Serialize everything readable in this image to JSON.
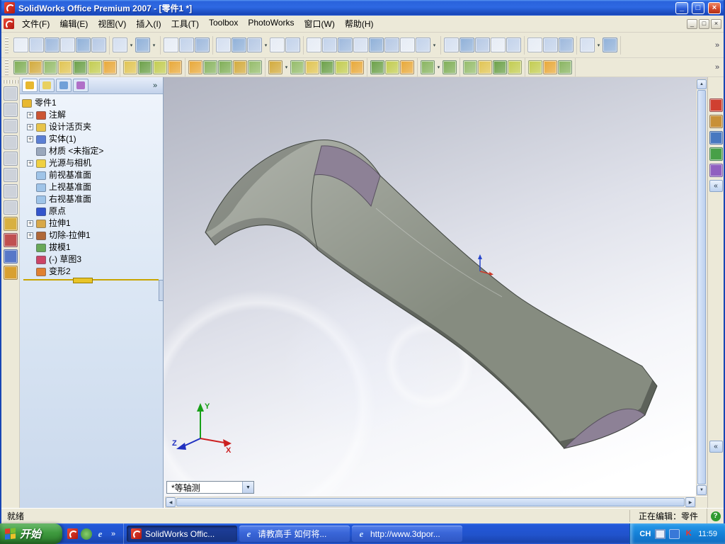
{
  "window": {
    "title": "SolidWorks Office Premium 2007 - [零件1 *]"
  },
  "menu": {
    "items": [
      "文件(F)",
      "编辑(E)",
      "视图(V)",
      "插入(I)",
      "工具(T)",
      "Toolbox",
      "PhotoWorks",
      "窗口(W)",
      "帮助(H)"
    ]
  },
  "toolbars": {
    "standard": {
      "groups": [
        [
          "new-document",
          "open-document",
          "save",
          "make-drawing-from-part",
          "make-assembly-from-part",
          "print"
        ],
        [
          "undo",
          "redo"
        ],
        [
          "select",
          "selection-filter",
          "record-macro"
        ],
        [
          "edit-color",
          "texture",
          "design-table",
          "options",
          "help"
        ],
        [
          "zoom-to-fit",
          "zoom-to-area",
          "zoom-in-out",
          "zoom-to-selection",
          "rotate-view",
          "pan",
          "previous-view",
          "standard-views"
        ],
        [
          "wireframe",
          "hidden-lines-visible",
          "hidden-lines-removed",
          "shaded-with-edges",
          "shaded"
        ],
        [
          "shadows-in-shaded-mode",
          "section-view",
          "realview-graphics"
        ],
        [
          "view-orientation",
          "fullscreen"
        ]
      ]
    },
    "features": {
      "groups": [
        [
          "sketch",
          "smart-dimension",
          "sketch-relations",
          "convert-entities",
          "offset-entities",
          "trim-entities",
          "mirror-entities"
        ],
        [
          "extruded-boss",
          "revolved-boss",
          "swept-boss",
          "lofted-boss"
        ],
        [
          "extruded-cut",
          "hole-wizard",
          "revolved-cut",
          "swept-cut",
          "lofted-cut"
        ],
        [
          "fillet",
          "chamfer",
          "rib",
          "shell",
          "draft",
          "dome"
        ],
        [
          "linear-pattern",
          "circular-pattern",
          "mirror-feature"
        ],
        [
          "reference-geometry",
          "curves"
        ],
        [
          "flex",
          "deform",
          "indent",
          "wrap"
        ],
        [
          "sheet-metal",
          "weldments",
          "mold-tools"
        ]
      ]
    },
    "dropdown_icons": [
      "undo",
      "redo",
      "design-table",
      "standard-views",
      "view-orientation",
      "reference-geometry",
      "fillet"
    ]
  },
  "left_toolbar": {
    "icons": [
      "select-tool",
      "front-view",
      "back-view",
      "left-view",
      "right-view",
      "top-view",
      "bottom-view",
      "isometric-view",
      "sketch-entity",
      "appearance",
      "move-copy",
      "measure"
    ]
  },
  "task_pane": {
    "tabs": [
      "solidworks-resources",
      "design-library",
      "file-explorer",
      "search-results",
      "custom-properties"
    ]
  },
  "feature_tree": {
    "root": {
      "label": "零件1",
      "icon": "part-icon"
    },
    "items": [
      {
        "label": "注解",
        "icon": "annotations-icon",
        "exp": true
      },
      {
        "label": "设计活页夹",
        "icon": "design-binder-icon",
        "exp": true
      },
      {
        "label": "实体(1)",
        "icon": "solid-bodies-icon",
        "exp": true
      },
      {
        "label": "材质 <未指定>",
        "icon": "material-icon",
        "exp": false
      },
      {
        "label": "光源与相机",
        "icon": "lights-cameras-icon",
        "exp": true
      },
      {
        "label": "前视基准面",
        "icon": "plane-icon",
        "exp": false
      },
      {
        "label": "上视基准面",
        "icon": "plane-icon",
        "exp": false
      },
      {
        "label": "右视基准面",
        "icon": "plane-icon",
        "exp": false
      },
      {
        "label": "原点",
        "icon": "origin-icon",
        "exp": false
      },
      {
        "label": "拉伸1",
        "icon": "extrude-icon",
        "exp": true
      },
      {
        "label": "切除-拉伸1",
        "icon": "cut-extrude-icon",
        "exp": true
      },
      {
        "label": "拔模1",
        "icon": "draft-icon",
        "exp": false
      },
      {
        "label": "(-) 草图3",
        "icon": "sketch-icon",
        "exp": false
      },
      {
        "label": "变形2",
        "icon": "deform-icon",
        "exp": false
      }
    ]
  },
  "viewport": {
    "orientation_combo": "*等轴测",
    "triad": {
      "x": "X",
      "y": "Y",
      "z": "Z"
    }
  },
  "status_bar": {
    "left": "就绪",
    "right": "正在编辑：零件"
  },
  "taskbar": {
    "start_label": "开始",
    "quick_launch": [
      "solidworks",
      "media-player",
      "internet-explorer"
    ],
    "tasks": [
      {
        "label": "SolidWorks Offic...",
        "icon": "solidworks",
        "active": true
      },
      {
        "label": "请教高手 如何将...",
        "icon": "ie",
        "active": false
      },
      {
        "label": "http://www.3dpor...",
        "icon": "ie",
        "active": false
      }
    ],
    "tray": {
      "input_indicator": "CH",
      "icons": [
        "keyboard-icon",
        "ime-icon",
        "kingsoft-icon"
      ],
      "time": "11:59"
    }
  },
  "icon_glyphs": {
    "dropdown": "▾",
    "overflow": "»",
    "collapse_left": "«",
    "plus": "+",
    "help": "?",
    "ie": "e",
    "combo_arrow": "▼",
    "scroll_up": "▲",
    "scroll_down": "▼",
    "scroll_left": "◀",
    "scroll_right": "▶",
    "win_min": "_",
    "win_restore": "□",
    "win_close": "×",
    "kingsoft": "K"
  },
  "colors": {
    "title_blue": "#2E68E2",
    "taskbar_blue": "#2153CC",
    "start_green": "#3F9B3F",
    "tray_blue": "#1581D8",
    "model_gray": "#868C80",
    "model_purple": "#8D8196",
    "rollback_yellow": "#C8A400"
  }
}
